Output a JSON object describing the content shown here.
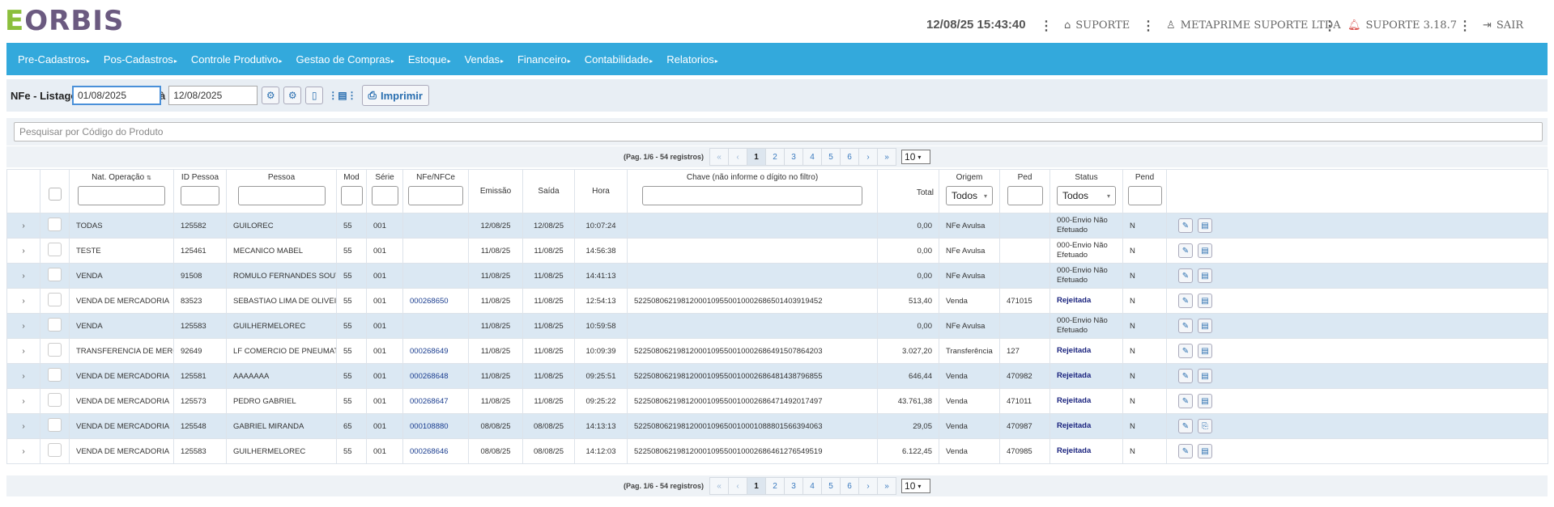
{
  "header": {
    "logo_first": "E",
    "logo_rest": "ORBIS",
    "datetime": "12/08/25 15:43:40",
    "support_label": "SUPORTE",
    "company_label": "METAPRIME SUPORTE LTDA",
    "version_label": "SUPORTE 3.18.7",
    "logout_label": "SAIR",
    "menu_dots": "⋮"
  },
  "nav": {
    "items": [
      {
        "label": "Pre-Cadastros"
      },
      {
        "label": "Pos-Cadastros"
      },
      {
        "label": "Controle Produtivo"
      },
      {
        "label": "Gestao de Compras"
      },
      {
        "label": "Estoque"
      },
      {
        "label": "Vendas"
      },
      {
        "label": "Financeiro"
      },
      {
        "label": "Contabilidade"
      },
      {
        "label": "Relatorios"
      }
    ],
    "caret": "▸"
  },
  "filter": {
    "title": "NFe - Listagem de",
    "date_from": "01/08/2025",
    "ate": "à",
    "date_to": "12/08/2025",
    "print_label": "Imprimir"
  },
  "search": {
    "placeholder": "Pesquisar por Código do Produto"
  },
  "pager": {
    "info": "(Pag. 1/6 - 54 registros)",
    "first": "«",
    "prev": "‹",
    "pages": [
      "1",
      "2",
      "3",
      "4",
      "5",
      "6"
    ],
    "next": "›",
    "last": "»",
    "page_size": "10",
    "caret": "▾"
  },
  "table": {
    "headers": {
      "nat_op": "Nat. Operação",
      "sort_icon": "⇅",
      "id_pessoa": "ID Pessoa",
      "pessoa": "Pessoa",
      "mod": "Mod",
      "serie": "Série",
      "nfe": "NFe/NFCe",
      "emissao": "Emissão",
      "saida": "Saída",
      "hora": "Hora",
      "chave": "Chave (não informe o dígito no filtro)",
      "total": "Total",
      "origem": "Origem",
      "ped": "Ped",
      "status": "Status",
      "pend": "Pend"
    },
    "filters": {
      "origem_value": "Todos",
      "status_value": "Todos"
    },
    "rows": [
      {
        "nat": "TODAS",
        "id": "125582",
        "pessoa": "GUILOREC",
        "mod": "55",
        "serie": "001",
        "nfe": "",
        "emissao": "12/08/25",
        "saida": "12/08/25",
        "hora": "10:07:24",
        "chave": "",
        "total": "0,00",
        "origem": "NFe Avulsa",
        "ped": "",
        "status": "000-Envio Não Efetuado",
        "pend": "N"
      },
      {
        "nat": "TESTE",
        "id": "125461",
        "pessoa": "MECANICO MABEL",
        "mod": "55",
        "serie": "001",
        "nfe": "",
        "emissao": "11/08/25",
        "saida": "11/08/25",
        "hora": "14:56:38",
        "chave": "",
        "total": "0,00",
        "origem": "NFe Avulsa",
        "ped": "",
        "status": "000-Envio Não Efetuado",
        "pend": "N"
      },
      {
        "nat": "VENDA",
        "id": "91508",
        "pessoa": "ROMULO FERNANDES SOUTO",
        "mod": "55",
        "serie": "001",
        "nfe": "",
        "emissao": "11/08/25",
        "saida": "11/08/25",
        "hora": "14:41:13",
        "chave": "",
        "total": "0,00",
        "origem": "NFe Avulsa",
        "ped": "",
        "status": "000-Envio Não Efetuado",
        "pend": "N"
      },
      {
        "nat": "VENDA DE MERCADORIA",
        "id": "83523",
        "pessoa": "SEBASTIAO LIMA DE OLIVEIRA",
        "mod": "55",
        "serie": "001",
        "nfe": "000268650",
        "emissao": "11/08/25",
        "saida": "11/08/25",
        "hora": "12:54:13",
        "chave": "52250806219812000109550010002686501403919452",
        "total": "513,40",
        "origem": "Venda",
        "ped": "471015",
        "status": "Rejeitada",
        "pend": "N"
      },
      {
        "nat": "VENDA",
        "id": "125583",
        "pessoa": "GUILHERMELOREC",
        "mod": "55",
        "serie": "001",
        "nfe": "",
        "emissao": "11/08/25",
        "saida": "11/08/25",
        "hora": "10:59:58",
        "chave": "",
        "total": "0,00",
        "origem": "NFe Avulsa",
        "ped": "",
        "status": "000-Envio Não Efetuado",
        "pend": "N"
      },
      {
        "nat": "TRANSFERENCIA DE MERCAD...",
        "id": "92649",
        "pessoa": "LF COMERCIO DE PNEUMATI...",
        "mod": "55",
        "serie": "001",
        "nfe": "000268649",
        "emissao": "11/08/25",
        "saida": "11/08/25",
        "hora": "10:09:39",
        "chave": "52250806219812000109550010002686491507864203",
        "total": "3.027,20",
        "origem": "Transferência",
        "ped": "127",
        "status": "Rejeitada",
        "pend": "N"
      },
      {
        "nat": "VENDA DE MERCADORIA",
        "id": "125581",
        "pessoa": "AAAAAAA",
        "mod": "55",
        "serie": "001",
        "nfe": "000268648",
        "emissao": "11/08/25",
        "saida": "11/08/25",
        "hora": "09:25:51",
        "chave": "52250806219812000109550010002686481438796855",
        "total": "646,44",
        "origem": "Venda",
        "ped": "470982",
        "status": "Rejeitada",
        "pend": "N"
      },
      {
        "nat": "VENDA DE MERCADORIA",
        "id": "125573",
        "pessoa": "PEDRO GABRIEL",
        "mod": "55",
        "serie": "001",
        "nfe": "000268647",
        "emissao": "11/08/25",
        "saida": "11/08/25",
        "hora": "09:25:22",
        "chave": "52250806219812000109550010002686471492017497",
        "total": "43.761,38",
        "origem": "Venda",
        "ped": "471011",
        "status": "Rejeitada",
        "pend": "N"
      },
      {
        "nat": "VENDA DE MERCADORIA",
        "id": "125548",
        "pessoa": "GABRIEL MIRANDA",
        "mod": "65",
        "serie": "001",
        "nfe": "000108880",
        "emissao": "08/08/25",
        "saida": "08/08/25",
        "hora": "14:13:13",
        "chave": "52250806219812000109650010001088801566394063",
        "total": "29,05",
        "origem": "Venda",
        "ped": "470987",
        "status": "Rejeitada",
        "pend": "N"
      },
      {
        "nat": "VENDA DE MERCADORIA",
        "id": "125583",
        "pessoa": "GUILHERMELOREC",
        "mod": "55",
        "serie": "001",
        "nfe": "000268646",
        "emissao": "08/08/25",
        "saida": "08/08/25",
        "hora": "14:12:03",
        "chave": "52250806219812000109550010002686461276549519",
        "total": "6.122,45",
        "origem": "Venda",
        "ped": "470985",
        "status": "Rejeitada",
        "pend": "N"
      }
    ],
    "expand_icon": "›"
  },
  "icons": {
    "home": "home-icon",
    "user": "user-icon",
    "bell": "bell-icon",
    "logout": "logout-icon",
    "settings": "gear-icon",
    "document": "document-icon",
    "print": "print-icon",
    "edit": "pencil-icon",
    "detail": "list-icon"
  },
  "colors": {
    "nav_bg": "#33a9dc",
    "row_alt": "#dbe8f3",
    "link": "#1a3d8f",
    "logo_green": "#8bbf3c",
    "logo_purple": "#6b5a80"
  }
}
